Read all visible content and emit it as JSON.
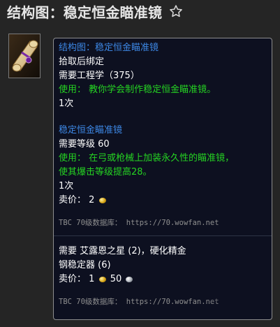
{
  "header": {
    "title": "结构图：稳定恒金瞄准镜"
  },
  "icons": {
    "favorite": "star-outline-icon",
    "item": "scroll-recipe-icon"
  },
  "tooltip": {
    "recipe_name": "结构图：稳定恒金瞄准镜",
    "bind": "拾取后绑定",
    "requires_skill": "需要工程学（375）",
    "use_line1": "使用：  教你学会制作稳定恒金瞄准镜。",
    "count1": "1次",
    "crafted_name": "稳定恒金瞄准镜",
    "requires_level": "需要等级 60",
    "use2_line1": "使用：  在弓或枪械上加装永久性的瞄准镜，",
    "use2_line2": "使其爆击等级提高28。",
    "count2": "1次",
    "sell_label": "卖价：",
    "sell_gold_1": "2",
    "source_label_1": "TBC 70级数据库：",
    "source_url_1": "https://70.wowfan.net",
    "req_mats_line1": "需要 艾露恩之星 (2)，硬化精金",
    "req_mats_line2": "钢稳定器 (6)",
    "sell_gold_2": "1",
    "sell_silver_2": "50",
    "source_label_2": "TBC 70级数据库：",
    "source_url_2": "https://70.wowfan.net"
  },
  "colors": {
    "blue": "#3d88e6",
    "green": "#25d322",
    "background": "#252525",
    "tooltip_bg": "#0d1020"
  }
}
